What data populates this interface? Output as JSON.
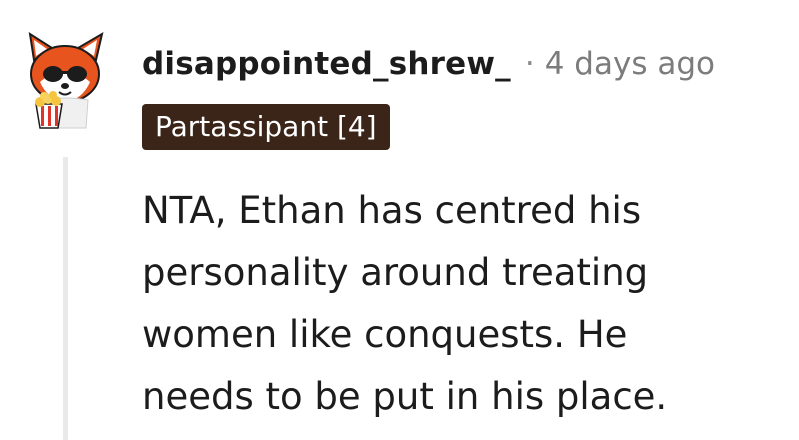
{
  "comment": {
    "username": "disappointed_shrew_",
    "separator": "·",
    "timestamp": "4 days ago",
    "flair": "Partassipant [4]",
    "body_lines": [
      "NTA, Ethan has centred his",
      "personality around treating",
      "women like conquests. He",
      "needs to be put in his place."
    ]
  },
  "avatar": {
    "icon": "red-panda-popcorn-avatar-icon"
  },
  "colors": {
    "flair_background": "#3b2418",
    "username": "#1c1c1c",
    "timestamp": "#7c7c7c",
    "thread_line": "#e9e9e9"
  }
}
